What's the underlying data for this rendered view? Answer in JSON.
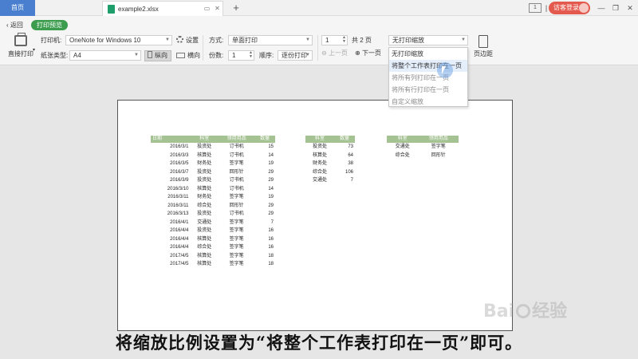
{
  "tabs": {
    "home": "首页",
    "file": "example2.xlsx",
    "login": "访客登录",
    "page_indicator": "1"
  },
  "toolbar": {
    "back": "返回",
    "preview_badge": "打印预览",
    "direct_print": "直接打印",
    "printer_label": "打印机:",
    "printer_value": "OneNote for Windows 10",
    "settings": "设置",
    "paper_label": "纸张类型:",
    "paper_value": "A4",
    "portrait": "纵向",
    "landscape": "横向",
    "mode_label": "方式:",
    "mode_value": "单面打印",
    "copies_label": "份数:",
    "copies_value": "1",
    "order_label": "顺序:",
    "order_value": "逐份打印",
    "page_value": "1",
    "total_pages": "共 2 页",
    "prev_page": "上一页",
    "next_page": "下一页",
    "scale_value": "无打印缩放",
    "margins": "页边距"
  },
  "scale_menu": [
    "无打印缩放",
    "将整个工作表打印在一页",
    "将所有列打印在一页",
    "将所有行打印在一页",
    "自定义缩放"
  ],
  "table1": {
    "headers": [
      "日期",
      "科室",
      "领用用品",
      "数量"
    ],
    "rows": [
      [
        "2016/3/1",
        "投资处",
        "订书机",
        "15"
      ],
      [
        "2016/3/3",
        "核算处",
        "订书机",
        "14"
      ],
      [
        "2016/3/5",
        "财务处",
        "签字笔",
        "19"
      ],
      [
        "2016/3/7",
        "投资处",
        "回形针",
        "29"
      ],
      [
        "2016/3/9",
        "投资处",
        "订书机",
        "29"
      ],
      [
        "2016/3/10",
        "核算处",
        "订书机",
        "14"
      ],
      [
        "2016/3/11",
        "财务处",
        "签字笔",
        "19"
      ],
      [
        "2016/3/11",
        "综合处",
        "回形针",
        "29"
      ],
      [
        "2016/3/13",
        "投资处",
        "订书机",
        "29"
      ],
      [
        "2016/4/1",
        "交通处",
        "签字笔",
        "7"
      ],
      [
        "2016/4/4",
        "投资处",
        "签字笔",
        "16"
      ],
      [
        "2016/4/4",
        "核算处",
        "签字笔",
        "16"
      ],
      [
        "2016/4/4",
        "综合处",
        "签字笔",
        "16"
      ],
      [
        "2017/4/5",
        "核算处",
        "签字笔",
        "18"
      ],
      [
        "2017/4/5",
        "核算处",
        "签字笔",
        "18"
      ]
    ]
  },
  "table2": {
    "headers": [
      "科室",
      "数量"
    ],
    "rows": [
      [
        "投资处",
        "73"
      ],
      [
        "核算处",
        "64"
      ],
      [
        "财务处",
        "38"
      ],
      [
        "综合处",
        "106"
      ],
      [
        "交通处",
        "7"
      ]
    ]
  },
  "table3": {
    "headers": [
      "科室",
      "领用用品"
    ],
    "rows": [
      [
        "交通处",
        "签字笔"
      ],
      [
        "综合处",
        "回形针"
      ]
    ]
  },
  "caption": "将缩放比例设置为“将整个工作表打印在一页”即可。",
  "watermark": "Bai 经验"
}
